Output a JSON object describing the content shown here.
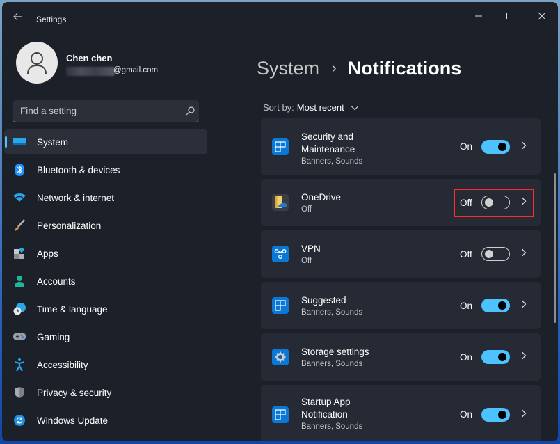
{
  "window": {
    "title": "Settings",
    "controls": {
      "minimize": "Minimize",
      "maximize": "Maximize",
      "close": "Close"
    }
  },
  "profile": {
    "name": "Chen chen",
    "email_suffix": "@gmail.com"
  },
  "search": {
    "placeholder": "Find a setting",
    "value": ""
  },
  "sidebar": {
    "items": [
      {
        "label": "System",
        "icon": "monitor-icon",
        "active": true
      },
      {
        "label": "Bluetooth & devices",
        "icon": "bluetooth-icon"
      },
      {
        "label": "Network & internet",
        "icon": "wifi-icon"
      },
      {
        "label": "Personalization",
        "icon": "paintbrush-icon"
      },
      {
        "label": "Apps",
        "icon": "apps-icon"
      },
      {
        "label": "Accounts",
        "icon": "person-icon"
      },
      {
        "label": "Time & language",
        "icon": "clock-globe-icon"
      },
      {
        "label": "Gaming",
        "icon": "gamepad-icon"
      },
      {
        "label": "Accessibility",
        "icon": "accessibility-icon"
      },
      {
        "label": "Privacy & security",
        "icon": "shield-icon"
      },
      {
        "label": "Windows Update",
        "icon": "update-icon"
      }
    ]
  },
  "breadcrumb": {
    "parent": "System",
    "separator": "›",
    "current": "Notifications"
  },
  "sort": {
    "label": "Sort by:",
    "value": "Most recent"
  },
  "notifications": [
    {
      "title_lines": [
        "Security and",
        "Maintenance"
      ],
      "subtitle": "Banners, Sounds",
      "state": "On",
      "on": true,
      "icon": "security-maintenance-icon"
    },
    {
      "title_lines": [
        "OneDrive"
      ],
      "subtitle": "Off",
      "state": "Off",
      "on": false,
      "icon": "onedrive-icon",
      "highlighted": true
    },
    {
      "title_lines": [
        "VPN"
      ],
      "subtitle": "Off",
      "state": "Off",
      "on": false,
      "icon": "vpn-icon"
    },
    {
      "title_lines": [
        "Suggested"
      ],
      "subtitle": "Banners, Sounds",
      "state": "On",
      "on": true,
      "icon": "suggested-icon"
    },
    {
      "title_lines": [
        "Storage settings"
      ],
      "subtitle": "Banners, Sounds",
      "state": "On",
      "on": true,
      "icon": "storage-gear-icon"
    },
    {
      "title_lines": [
        "Startup App",
        "Notification"
      ],
      "subtitle": "Banners, Sounds",
      "state": "On",
      "on": true,
      "icon": "startup-app-icon"
    }
  ],
  "colors": {
    "accent": "#4cc2ff",
    "window_bg": "#1c2029",
    "card_bg": "#262a34",
    "highlight": "#ff2a2a"
  }
}
